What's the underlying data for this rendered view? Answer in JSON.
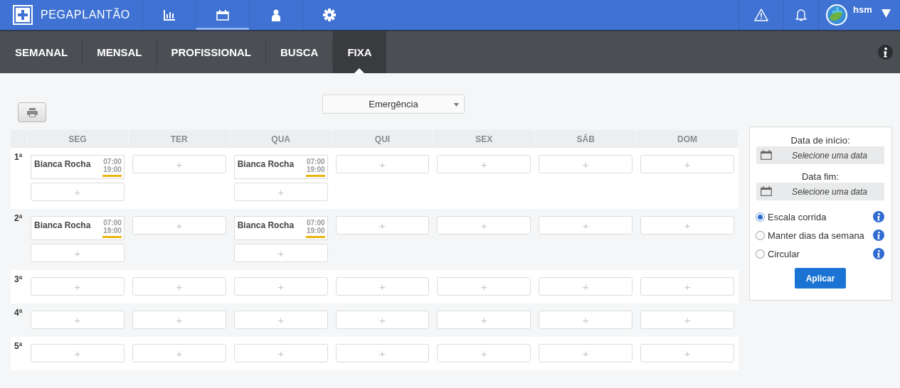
{
  "app": {
    "name": "PEGAPLANTÃO"
  },
  "nav": [
    {
      "kind": "chart",
      "selected": false
    },
    {
      "kind": "calendar",
      "selected": true
    },
    {
      "kind": "person",
      "selected": false
    },
    {
      "kind": "settings",
      "selected": false
    }
  ],
  "user": {
    "name": "hsm"
  },
  "tabs": [
    {
      "label": "SEMANAL",
      "selected": false
    },
    {
      "label": "MENSAL",
      "selected": false
    },
    {
      "label": "PROFISSIONAL",
      "selected": false
    },
    {
      "label": "BUSCA",
      "selected": false
    },
    {
      "label": "FIXA",
      "selected": true
    }
  ],
  "toolbar": {
    "department": "Emergência"
  },
  "schedule": {
    "days": [
      "SEG",
      "TER",
      "QUA",
      "QUI",
      "SEX",
      "SÁB",
      "DOM"
    ],
    "rows": [
      {
        "label": "1ª",
        "cells": [
          [
            {
              "kind": "shift",
              "name": "Bianca Rocha",
              "start": "07:00",
              "end": "19:00"
            },
            {
              "kind": "add",
              "label": "+"
            }
          ],
          [
            {
              "kind": "add",
              "label": "+"
            }
          ],
          [
            {
              "kind": "shift",
              "name": "Bianca Rocha",
              "start": "07:00",
              "end": "19:00"
            },
            {
              "kind": "add",
              "label": "+"
            }
          ],
          [
            {
              "kind": "add",
              "label": "+"
            }
          ],
          [
            {
              "kind": "add",
              "label": "+"
            }
          ],
          [
            {
              "kind": "add",
              "label": "+"
            }
          ],
          [
            {
              "kind": "add",
              "label": "+"
            }
          ]
        ]
      },
      {
        "label": "2ª",
        "cells": [
          [
            {
              "kind": "shift",
              "name": "Bianca Rocha",
              "start": "07:00",
              "end": "19:00"
            },
            {
              "kind": "add",
              "label": "+"
            }
          ],
          [
            {
              "kind": "add",
              "label": "+"
            }
          ],
          [
            {
              "kind": "shift",
              "name": "Bianca Rocha",
              "start": "07:00",
              "end": "19:00"
            },
            {
              "kind": "add",
              "label": "+"
            }
          ],
          [
            {
              "kind": "add",
              "label": "+"
            }
          ],
          [
            {
              "kind": "add",
              "label": "+"
            }
          ],
          [
            {
              "kind": "add",
              "label": "+"
            }
          ],
          [
            {
              "kind": "add",
              "label": "+"
            }
          ]
        ]
      },
      {
        "label": "3ª",
        "cells": [
          [
            {
              "kind": "add",
              "label": "+"
            }
          ],
          [
            {
              "kind": "add",
              "label": "+"
            }
          ],
          [
            {
              "kind": "add",
              "label": "+"
            }
          ],
          [
            {
              "kind": "add",
              "label": "+"
            }
          ],
          [
            {
              "kind": "add",
              "label": "+"
            }
          ],
          [
            {
              "kind": "add",
              "label": "+"
            }
          ],
          [
            {
              "kind": "add",
              "label": "+"
            }
          ]
        ]
      },
      {
        "label": "4ª",
        "cells": [
          [
            {
              "kind": "add",
              "label": "+"
            }
          ],
          [
            {
              "kind": "add",
              "label": "+"
            }
          ],
          [
            {
              "kind": "add",
              "label": "+"
            }
          ],
          [
            {
              "kind": "add",
              "label": "+"
            }
          ],
          [
            {
              "kind": "add",
              "label": "+"
            }
          ],
          [
            {
              "kind": "add",
              "label": "+"
            }
          ],
          [
            {
              "kind": "add",
              "label": "+"
            }
          ]
        ]
      },
      {
        "label": "5ª",
        "cells": [
          [
            {
              "kind": "add",
              "label": "+"
            }
          ],
          [
            {
              "kind": "add",
              "label": "+"
            }
          ],
          [
            {
              "kind": "add",
              "label": "+"
            }
          ],
          [
            {
              "kind": "add",
              "label": "+"
            }
          ],
          [
            {
              "kind": "add",
              "label": "+"
            }
          ],
          [
            {
              "kind": "add",
              "label": "+"
            }
          ],
          [
            {
              "kind": "add",
              "label": "+"
            }
          ]
        ]
      }
    ]
  },
  "panel": {
    "start_label": "Data de início:",
    "start_placeholder": "Selecione uma data",
    "end_label": "Data fim:",
    "end_placeholder": "Selecione uma data",
    "options": [
      {
        "label": "Escala corrida",
        "selected": true
      },
      {
        "label": "Manter dias da semana",
        "selected": false
      },
      {
        "label": "Circular",
        "selected": false
      }
    ],
    "apply": "Aplicar"
  }
}
